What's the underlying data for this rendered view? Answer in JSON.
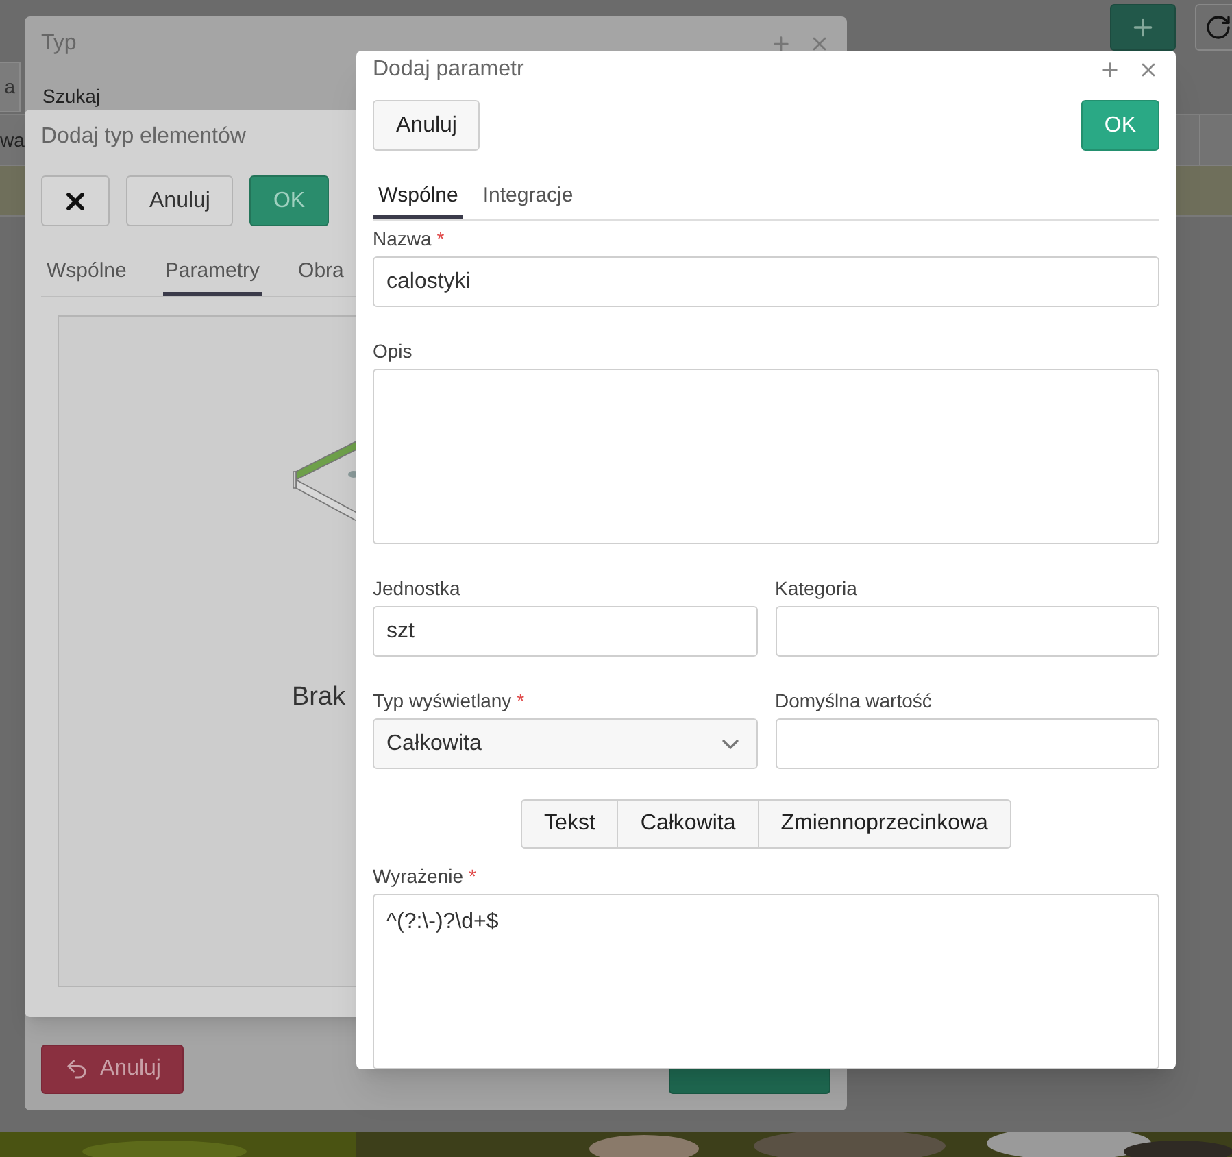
{
  "background": {
    "tab_fragment": "a",
    "table": {
      "columns": [
        "wa"
      ],
      "rows": [
        {
          "selected": true
        }
      ]
    }
  },
  "typ_window": {
    "title": "Typ",
    "search_label": "Szukaj",
    "footer_buttons": [
      {
        "kind": "cancel",
        "label": "Anuluj"
      },
      {
        "kind": "confirm"
      }
    ]
  },
  "element_type_window": {
    "title": "Dodaj typ elementów",
    "buttons": [
      {
        "kind": "close"
      },
      {
        "kind": "cancel",
        "label": "Anuluj"
      },
      {
        "kind": "confirm",
        "label": "OK"
      }
    ],
    "tabs": [
      {
        "label": "Wspólne",
        "selected": false
      },
      {
        "label": "Parametry",
        "selected": true
      },
      {
        "label": "Obra",
        "selected": false
      }
    ],
    "preview": {
      "message": "Brak"
    }
  },
  "dialog": {
    "title": "Dodaj parametr",
    "required_mark": "*",
    "buttons": [
      {
        "kind": "cancel",
        "label": "Anuluj"
      },
      {
        "kind": "confirm",
        "label": "OK"
      }
    ],
    "tabs": [
      {
        "label": "Wspólne",
        "selected": true
      },
      {
        "label": "Integracje",
        "selected": false
      }
    ],
    "form": [
      {
        "kind": "text",
        "label": "Nazwa",
        "required": true,
        "value": "calostyki"
      },
      {
        "kind": "textarea",
        "label": "Opis",
        "required": false
      },
      {
        "kind": "pair",
        "fields": [
          {
            "kind": "text",
            "label": "Jednostka",
            "required": false,
            "value": "szt"
          },
          {
            "kind": "text",
            "label": "Kategoria",
            "required": false
          }
        ]
      },
      {
        "kind": "pair",
        "fields": [
          {
            "kind": "select",
            "label": "Typ wyświetlany",
            "required": true,
            "value": "Całkowita"
          },
          {
            "kind": "text",
            "label": "Domyślna wartość",
            "required": false
          }
        ]
      },
      {
        "kind": "buttons",
        "items": [
          {
            "label": "Tekst"
          },
          {
            "label": "Całkowita"
          },
          {
            "label": "Zmiennoprzecinkowa"
          }
        ]
      },
      {
        "kind": "textarea",
        "label": "Wyrażenie",
        "required": true,
        "value": "^(?:\\-)?\\d+$"
      }
    ]
  }
}
